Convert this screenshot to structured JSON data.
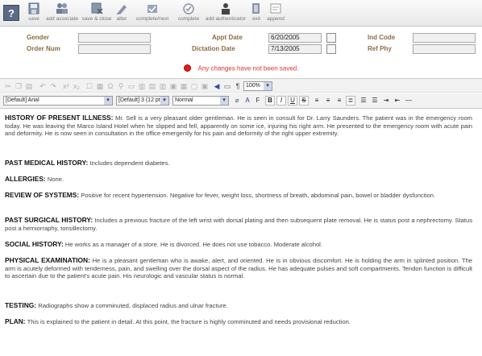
{
  "toolbar": {
    "help_label": "?",
    "buttons": [
      {
        "label": "save",
        "icon": "save-icon"
      },
      {
        "label": "add associate",
        "icon": "add-associate-icon"
      },
      {
        "label": "save & close",
        "icon": "save-close-icon"
      },
      {
        "label": "alter",
        "icon": "alter-icon"
      },
      {
        "label": "complete/next",
        "icon": "complete-next-icon"
      },
      {
        "label": "complete",
        "icon": "complete-icon"
      },
      {
        "label": "add authenticator",
        "icon": "add-authenticator-icon"
      },
      {
        "label": "exit",
        "icon": "exit-icon"
      },
      {
        "label": "append",
        "icon": "append-icon"
      }
    ]
  },
  "form": {
    "gender_label": "Gender",
    "gender_value": "",
    "order_num_label": "Order Num",
    "order_num_value": "",
    "appt_date_label": "Appt Date",
    "appt_date_value": "6/20/2005",
    "dictation_date_label": "Dictation Date",
    "dictation_date_value": "7/13/2005",
    "ind_code_label": "Ind Code",
    "ind_code_value": "",
    "ref_phy_label": "Ref Phy",
    "ref_phy_value": ""
  },
  "notice": "Any changes have not been saved.",
  "editor": {
    "font_family": "[Default] Arial",
    "font_size": "[Default] 3 (12 pt)",
    "style": "Normal",
    "zoom": "100%"
  },
  "document": [
    {
      "heading": "HISTORY OF PRESENT ILLNESS:",
      "text": " Mr. Sell is a very pleasant older gentleman. He is seen in consult for Dr. Larry Saunders. The patient was in the emergency room today. He was leaving the Marco Island Hotel when he slipped and fell, apparently on some ice, injuring his right arm. He presented to the emergency room with acute pain and deformity. He is now seen in consultation in the office emergently for his pain and deformity of the right upper extremity."
    },
    {
      "heading": "PAST MEDICAL HISTORY:",
      "text": " Includes dependent diabetes."
    },
    {
      "heading": "ALLERGIES:",
      "text": " None."
    },
    {
      "heading": "REVIEW OF SYSTEMS:",
      "text": " Positive for recent hypertension. Negative for fever, weight loss, shortness of breath, abdominal pain, bowel or bladder dysfunction."
    },
    {
      "heading": "PAST SURGICAL HISTORY:",
      "text": " Includes a previous fracture of the left wrist with dorsal plating and then subsequent plate removal. He is status post a nephrectomy. Status post a herniorraphy, tonsillectomy."
    },
    {
      "heading": "SOCIAL HISTORY:",
      "text": " He works as a manager of a store. He is divorced. He does not use tobacco. Moderate alcohol."
    },
    {
      "heading": "PHYSICAL EXAMINATION:",
      "text": " He is a pleasant gentleman who is awake, alert, and oriented. He is in obvious discomfort. He is holding the arm in splinted position. The arm is acutely deformed with tenderness, pain, and swelling over the dorsal aspect of the radius. He has adequate pulses and soft compartments. Tendon function is difficult to ascertain due to the patient's acute pain. His neurologic and vascular status is normal."
    },
    {
      "heading": "TESTING:",
      "text": " Radiographs show a comminuted, displaced radius and ulnar fracture."
    },
    {
      "heading": "PLAN:",
      "text": " This is explained to the patient in detail. At this point, the fracture is highly comminuted and needs provisional reduction."
    }
  ]
}
